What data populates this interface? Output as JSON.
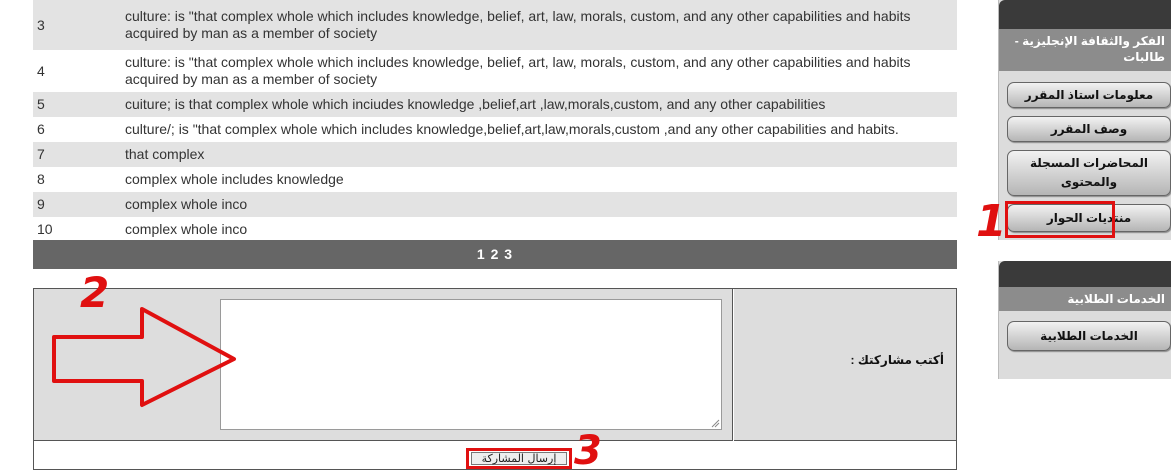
{
  "posts": [
    {
      "num": "3",
      "text": "culture: is \"that complex whole which includes knowledge, belief, art, law, morals, custom, and any other capabilities and habits acquired by man as a member of society"
    },
    {
      "num": "4",
      "text": "culture: is \"that complex whole which includes knowledge, belief, art, law, morals, custom, and any other capabilities and habits acquired by man as a member of society"
    },
    {
      "num": "5",
      "text": "cuiture; is that complex whole which inciudes knowledge ,belief,art ,law,morals,custom, and any other capabilities"
    },
    {
      "num": "6",
      "text": "culture/; is \"that complex whole which includes knowledge,belief,art,law,morals,custom ,and any other capabilities and habits."
    },
    {
      "num": "7",
      "text": "that complex"
    },
    {
      "num": "8",
      "text": "complex whole includes knowledge"
    },
    {
      "num": "9",
      "text": "complex whole inco"
    },
    {
      "num": "10",
      "text": "complex whole inco"
    }
  ],
  "pager": {
    "label": "1 2 3"
  },
  "form": {
    "label": "أكتب مشاركتك :",
    "textarea_value": "",
    "submit_label": "إرسال المشاركة"
  },
  "sidebar": {
    "course_title": "الفكر والثقافة الإنجليزية - طالبات",
    "course_links": [
      "معلومات استاذ المقرر",
      "وصف المقرر",
      "المحاضرات المسجلة والمحتوى",
      "منتديات الحوار"
    ],
    "services_title": "الخدمات الطلابية",
    "services_links": [
      "الخدمات الطلابية"
    ]
  },
  "annotations": {
    "one": "1",
    "two": "2",
    "three": "3"
  },
  "colors": {
    "annotation_red": "#e01010",
    "pager_bg": "#666666",
    "sidebar_header": "#3a3a3a",
    "sidebar_title_bg": "#8c8c8c"
  }
}
